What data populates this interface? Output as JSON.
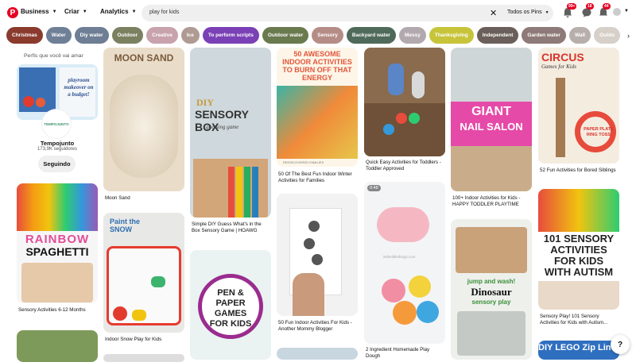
{
  "header": {
    "logo": "P",
    "nav": [
      {
        "label": "Business"
      },
      {
        "label": "Criar"
      },
      {
        "label": "Analytics"
      }
    ],
    "search": {
      "query": "play for kids",
      "scope": "Todos os Pins"
    },
    "badges": {
      "notifications": "99+",
      "messages": "18",
      "updates": "44"
    }
  },
  "chips": [
    {
      "label": "Christmas",
      "color": "#8a3b2e"
    },
    {
      "label": "Water",
      "color": "#6f7f96"
    },
    {
      "label": "Diy water",
      "color": "#6e7e94"
    },
    {
      "label": "Outdoor",
      "color": "#7b8060"
    },
    {
      "label": "Creative",
      "color": "#c8a2ad"
    },
    {
      "label": "Ice",
      "color": "#b09a94"
    },
    {
      "label": "To perform scripts",
      "color": "#7a40b6"
    },
    {
      "label": "Outdoor water",
      "color": "#6a7a4f"
    },
    {
      "label": "Sensory",
      "color": "#b58d86"
    },
    {
      "label": "Backyard water",
      "color": "#4f6a5a"
    },
    {
      "label": "Messy",
      "color": "#b2a9ae"
    },
    {
      "label": "Thanksgiving",
      "color": "#c7c43a"
    },
    {
      "label": "Independent",
      "color": "#6a5f5a"
    },
    {
      "label": "Garden water",
      "color": "#8e7a78"
    },
    {
      "label": "Wall",
      "color": "#b8afac"
    },
    {
      "label": "Outdo",
      "color": "#d6d0c8"
    }
  ],
  "profile": {
    "section_title": "Perfis que você vai amar",
    "image_text": "playroom makeover on a budget!",
    "avatar_text": "TEMPOJUNTO",
    "name": "Tempojunto",
    "followers": "173,9K seguidores",
    "follow_button": "Seguindo"
  },
  "pins": {
    "rainbow": {
      "big1": "RAINBOW",
      "big2": "SPAGHETTI",
      "caption": "Sensory Activities 6-12 Months"
    },
    "moon": {
      "title": "MOON SAND",
      "caption": "Moon Sand"
    },
    "snow": {
      "title": "Paint the SNOW",
      "caption": "Indoor Snow Play for Kids"
    },
    "sensorybox": {
      "line1": "DIY",
      "line2": "SENSORY BOX",
      "line3": "guessing game",
      "caption": "Simple DIY Guess What's in the Box Sensory Game | HOAWG"
    },
    "pen": {
      "text": "PEN & PAPER GAMES FOR KIDS"
    },
    "awesome": {
      "text": "50 AWESOME INDOOR ACTIVITIES TO BURN OFF THAT ENERGY",
      "source": "REDISCOVERED FAMILIES",
      "caption": "50 Of The Best Fun Indoor Winter Activities for Families"
    },
    "paper": {
      "caption": "50 Fun Indoor Activities For Kids - Another Mommy Blogger"
    },
    "toddler": {
      "caption": "Quick Easy Activities for Toddlers - Toddler Approved"
    },
    "dough": {
      "duration": "0:48",
      "watermark": "itsthelittlethings.com",
      "caption": "2 Ingredient Homemade Play Dough"
    },
    "nail": {
      "line1": "GIANT",
      "line2": "NAIL SALON",
      "caption": "100+ Indoor Activities for Kids - HAPPY TODDLER PLAYTIME"
    },
    "dinosaur": {
      "line1": "jump and wash!",
      "line2": "Dinosaur",
      "line3": "sensory play"
    },
    "circus": {
      "line1": "CIRCUS",
      "line2": "Games for Kids",
      "line3": "PAPER PLATE RING TOSS",
      "caption": "52 Fun Activities for Bored Siblings"
    },
    "autism": {
      "text": "101 SENSORY ACTIVITIES FOR KIDS WITH AUTISM",
      "caption": "Sensory Play! 101 Sensory Activities for Kids with Autism..."
    },
    "lego": {
      "text": "DIY LEGO Zip Line Activity"
    }
  },
  "help": "?"
}
